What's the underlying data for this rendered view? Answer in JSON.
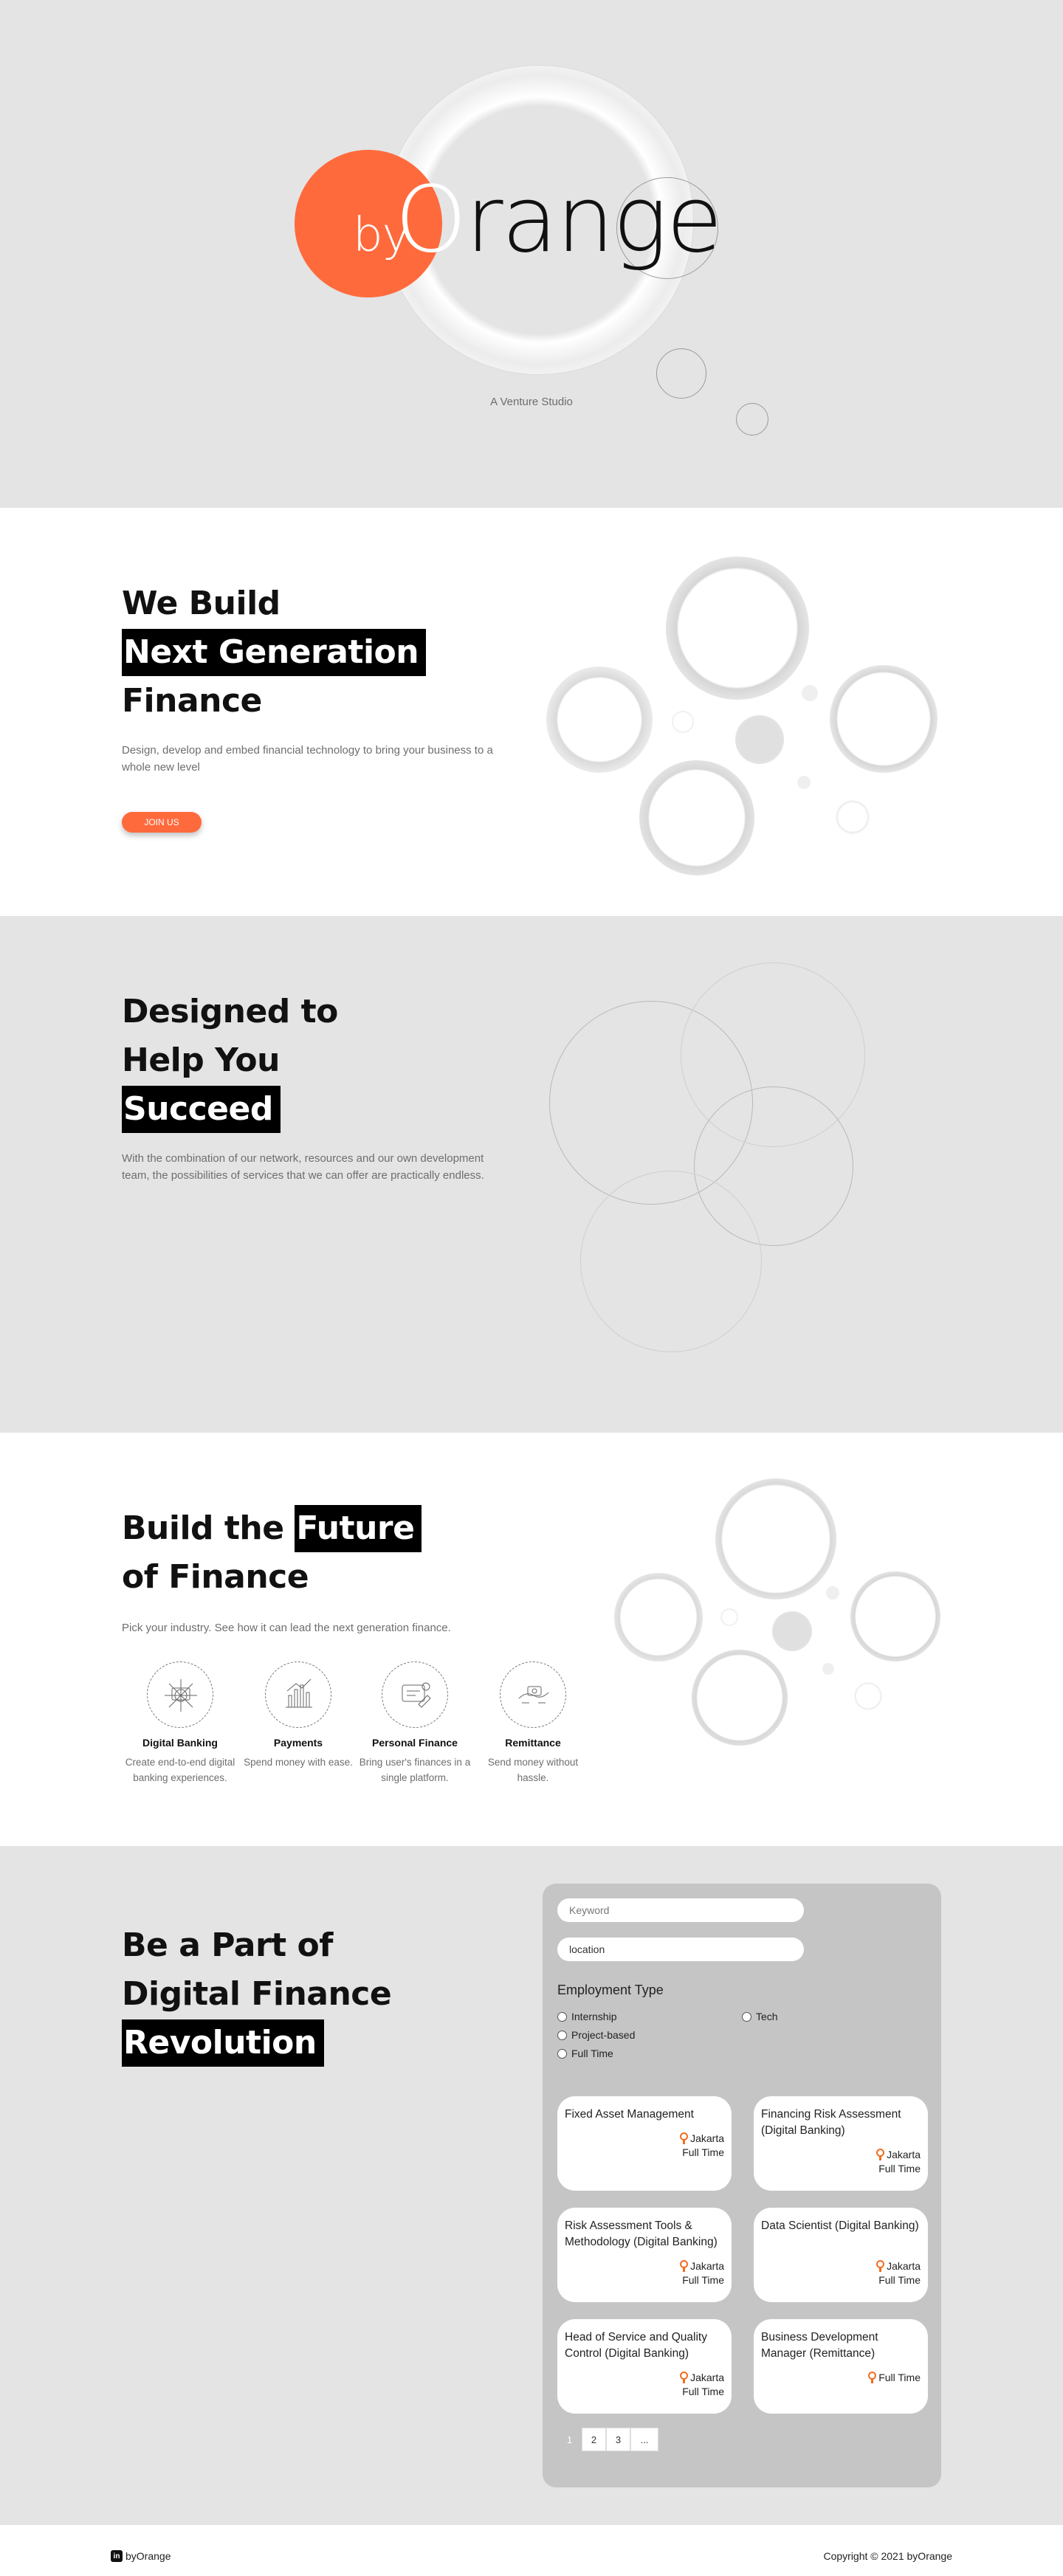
{
  "hero": {
    "logo_by": "by",
    "logo_o": "O",
    "logo_rest": "range",
    "tagline": "A Venture Studio",
    "accent": "#ff6a3d"
  },
  "build": {
    "line1": "We Build",
    "highlight": "Next Generation",
    "line3": "Finance",
    "description": "Design, develop and embed financial technology to bring your business to a whole new level",
    "cta": "JOIN US"
  },
  "designed": {
    "line1": "Designed to",
    "line2": "Help You",
    "highlight": "Succeed",
    "description": "With the combination of our network, resources and our own development team, the possibilities of services that we can offer are practically endless."
  },
  "future": {
    "line1_pre": "Build the ",
    "highlight": "Future",
    "line2": "of Finance",
    "description": "Pick your industry. See how it can lead the next generation finance.",
    "services": [
      {
        "title": "Digital Banking",
        "desc": "Create end-to-end digital banking experiences.",
        "icon": "bank-network-icon"
      },
      {
        "title": "Payments",
        "desc": "Spend money with ease.",
        "icon": "payment-chart-icon"
      },
      {
        "title": "Personal Finance",
        "desc": "Bring user's finances in a single platform.",
        "icon": "personal-finance-icon"
      },
      {
        "title": "Remittance",
        "desc": "Send money without hassle.",
        "icon": "remittance-icon"
      }
    ]
  },
  "careers": {
    "line1": "Be a Part of",
    "line2": "Digital Finance",
    "highlight": "Revolution",
    "keyword_placeholder": "Keyword",
    "location_value": "location",
    "employment_title": "Employment Type",
    "types": [
      "Internship",
      "Project-based",
      "Full Time",
      "Tech"
    ],
    "jobs": [
      {
        "title": "Fixed Asset Management",
        "location": "Jakarta",
        "type": "Full Time"
      },
      {
        "title": "Financing Risk Assessment (Digital Banking)",
        "location": "Jakarta",
        "type": "Full Time"
      },
      {
        "title": "Risk Assessment Tools & Methodology (Digital Banking)",
        "location": "Jakarta",
        "type": "Full Time"
      },
      {
        "title": "Data Scientist (Digital Banking)",
        "location": "Jakarta",
        "type": "Full Time"
      },
      {
        "title": "Head of Service and Quality Control (Digital Banking)",
        "location": "Jakarta",
        "type": "Full Time"
      },
      {
        "title": "Business Development Manager (Remittance)",
        "location": "",
        "type": "Full Time"
      }
    ],
    "pages": [
      "1",
      "2",
      "3",
      "..."
    ]
  },
  "footer": {
    "brand": "byOrange",
    "linkedin_glyph": "in",
    "copyright": "Copyright © 2021 byOrange"
  }
}
